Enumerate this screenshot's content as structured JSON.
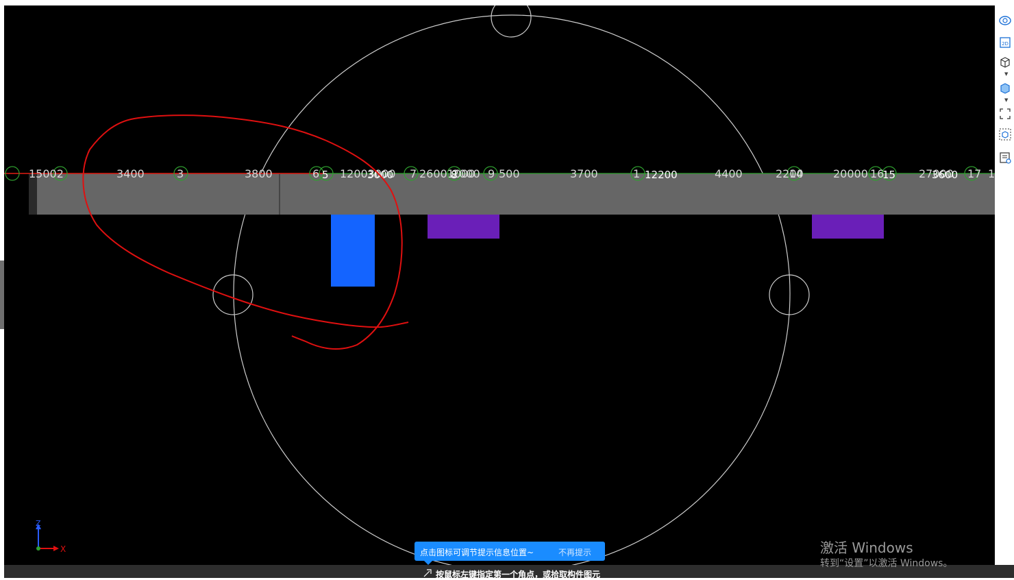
{
  "gridlines": {
    "axis_numbers": [
      "5",
      "8",
      "12",
      "15"
    ],
    "dimensions": [
      "15002",
      "3400",
      "3",
      "3800",
      "6",
      "12003000",
      "3000",
      "7",
      "26001000",
      "2000",
      "9",
      "500",
      "3700",
      "1",
      "12200",
      "4400",
      "2200",
      "14",
      "20000",
      "16",
      "27000",
      "3600",
      "17",
      "16"
    ]
  },
  "axis_gizmo": {
    "z_label": "Z",
    "x_label": "X"
  },
  "tip": {
    "message": "点击图标可调节提示信息位置~",
    "dismiss": "不再提示"
  },
  "status": {
    "prompt": "按鼠标左键指定第一个角点，或拾取构件图元"
  },
  "watermark": {
    "title": "激活 Windows",
    "subtitle": "转到“设置”以激活 Windows。"
  },
  "toolbar": {
    "icons": [
      "orbit-icon",
      "view-2d-icon",
      "view-3d-wire-icon",
      "view-3d-solid-icon",
      "zoom-extents-icon",
      "isolate-icon",
      "layer-visibility-icon"
    ],
    "label_2d": "2D"
  },
  "colors": {
    "viewport_bg": "#000000",
    "beam_gray": "#666666",
    "column_blue": "#1464ff",
    "slab_purple": "#6a1fb8",
    "grid_green": "#2fa02f",
    "annotation_red": "#e01010",
    "tip_blue": "#1a8cff"
  }
}
